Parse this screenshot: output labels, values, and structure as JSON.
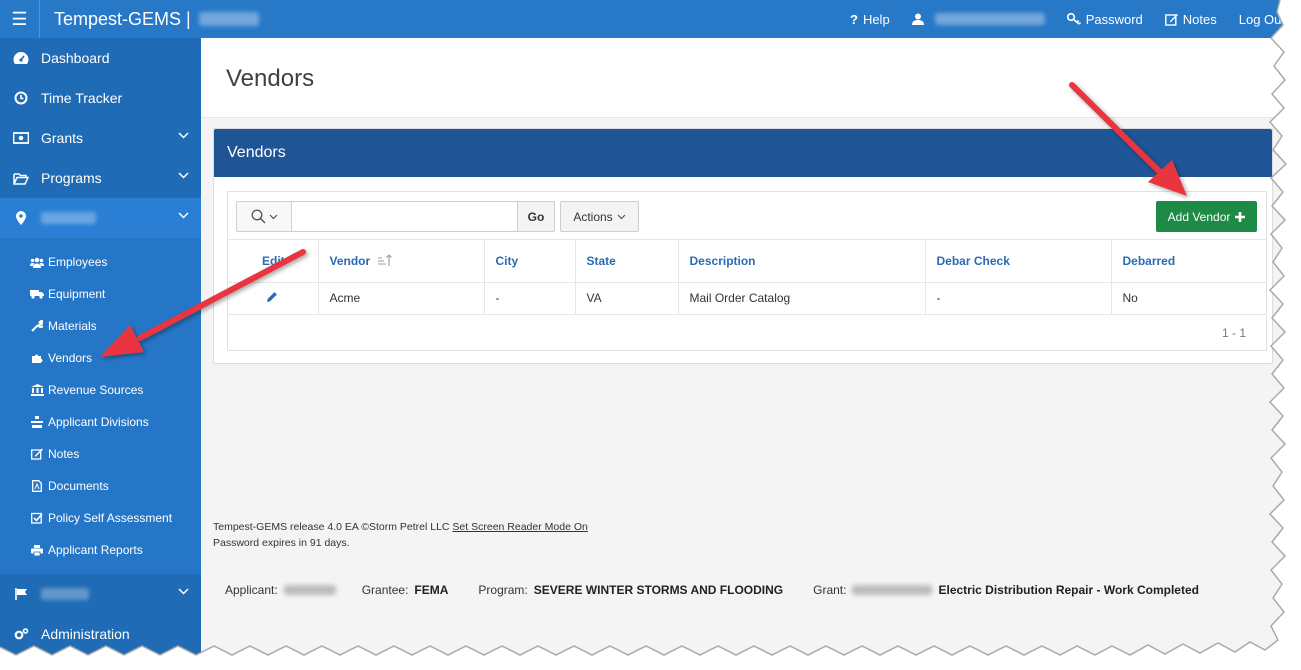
{
  "topbar": {
    "app_title": "Tempest-GEMS |",
    "help": "Help",
    "password": "Password",
    "notes": "Notes",
    "logout": "Log Out"
  },
  "sidebar": {
    "items": [
      {
        "label": "Dashboard",
        "icon": "dashboard-icon"
      },
      {
        "label": "Time Tracker",
        "icon": "clock-icon"
      },
      {
        "label": "Grants",
        "icon": "money-icon"
      },
      {
        "label": "Programs",
        "icon": "folder-open-icon"
      }
    ],
    "sub_items": [
      {
        "label": "Employees",
        "icon": "users-icon"
      },
      {
        "label": "Equipment",
        "icon": "truck-icon"
      },
      {
        "label": "Materials",
        "icon": "wrench-icon"
      },
      {
        "label": "Vendors",
        "icon": "puzzle-icon"
      },
      {
        "label": "Revenue Sources",
        "icon": "bank-icon"
      },
      {
        "label": "Applicant Divisions",
        "icon": "divisions-icon"
      },
      {
        "label": "Notes",
        "icon": "edit-icon"
      },
      {
        "label": "Documents",
        "icon": "pdf-icon"
      },
      {
        "label": "Policy Self Assessment",
        "icon": "check-square-icon"
      },
      {
        "label": "Applicant Reports",
        "icon": "print-icon"
      }
    ],
    "admin_label": "Administration"
  },
  "page": {
    "title": "Vendors"
  },
  "region": {
    "title": "Vendors"
  },
  "toolbar": {
    "go_label": "Go",
    "actions_label": "Actions",
    "add_label": "Add Vendor",
    "search_value": ""
  },
  "table": {
    "columns": [
      "Edit",
      "Vendor",
      "City",
      "State",
      "Description",
      "Debar Check",
      "Debarred"
    ],
    "rows": [
      {
        "vendor": "Acme",
        "city": "-",
        "state": "VA",
        "description": "Mail Order Catalog",
        "debar_check": "-",
        "debarred": "No"
      }
    ],
    "pagination": "1 - 1"
  },
  "footer": {
    "release": "Tempest-GEMS release 4.0 EA ©Storm Petrel LLC",
    "screen_reader": "Set Screen Reader Mode On",
    "password_expiry": "Password expires in 91 days."
  },
  "applicant_bar": {
    "applicant_label": "Applicant:",
    "grantee_label": "Grantee:",
    "grantee_value": "FEMA",
    "program_label": "Program:",
    "program_value": "SEVERE WINTER STORMS AND FLOODING",
    "grant_label": "Grant:",
    "grant_value": "Electric Distribution Repair - Work Completed"
  },
  "colors": {
    "topbar": "#2878c8",
    "sidebar": "#1f6bb5",
    "region_header": "#1f5597",
    "add_button": "#1d8a46",
    "arrow": "#e8363f"
  }
}
